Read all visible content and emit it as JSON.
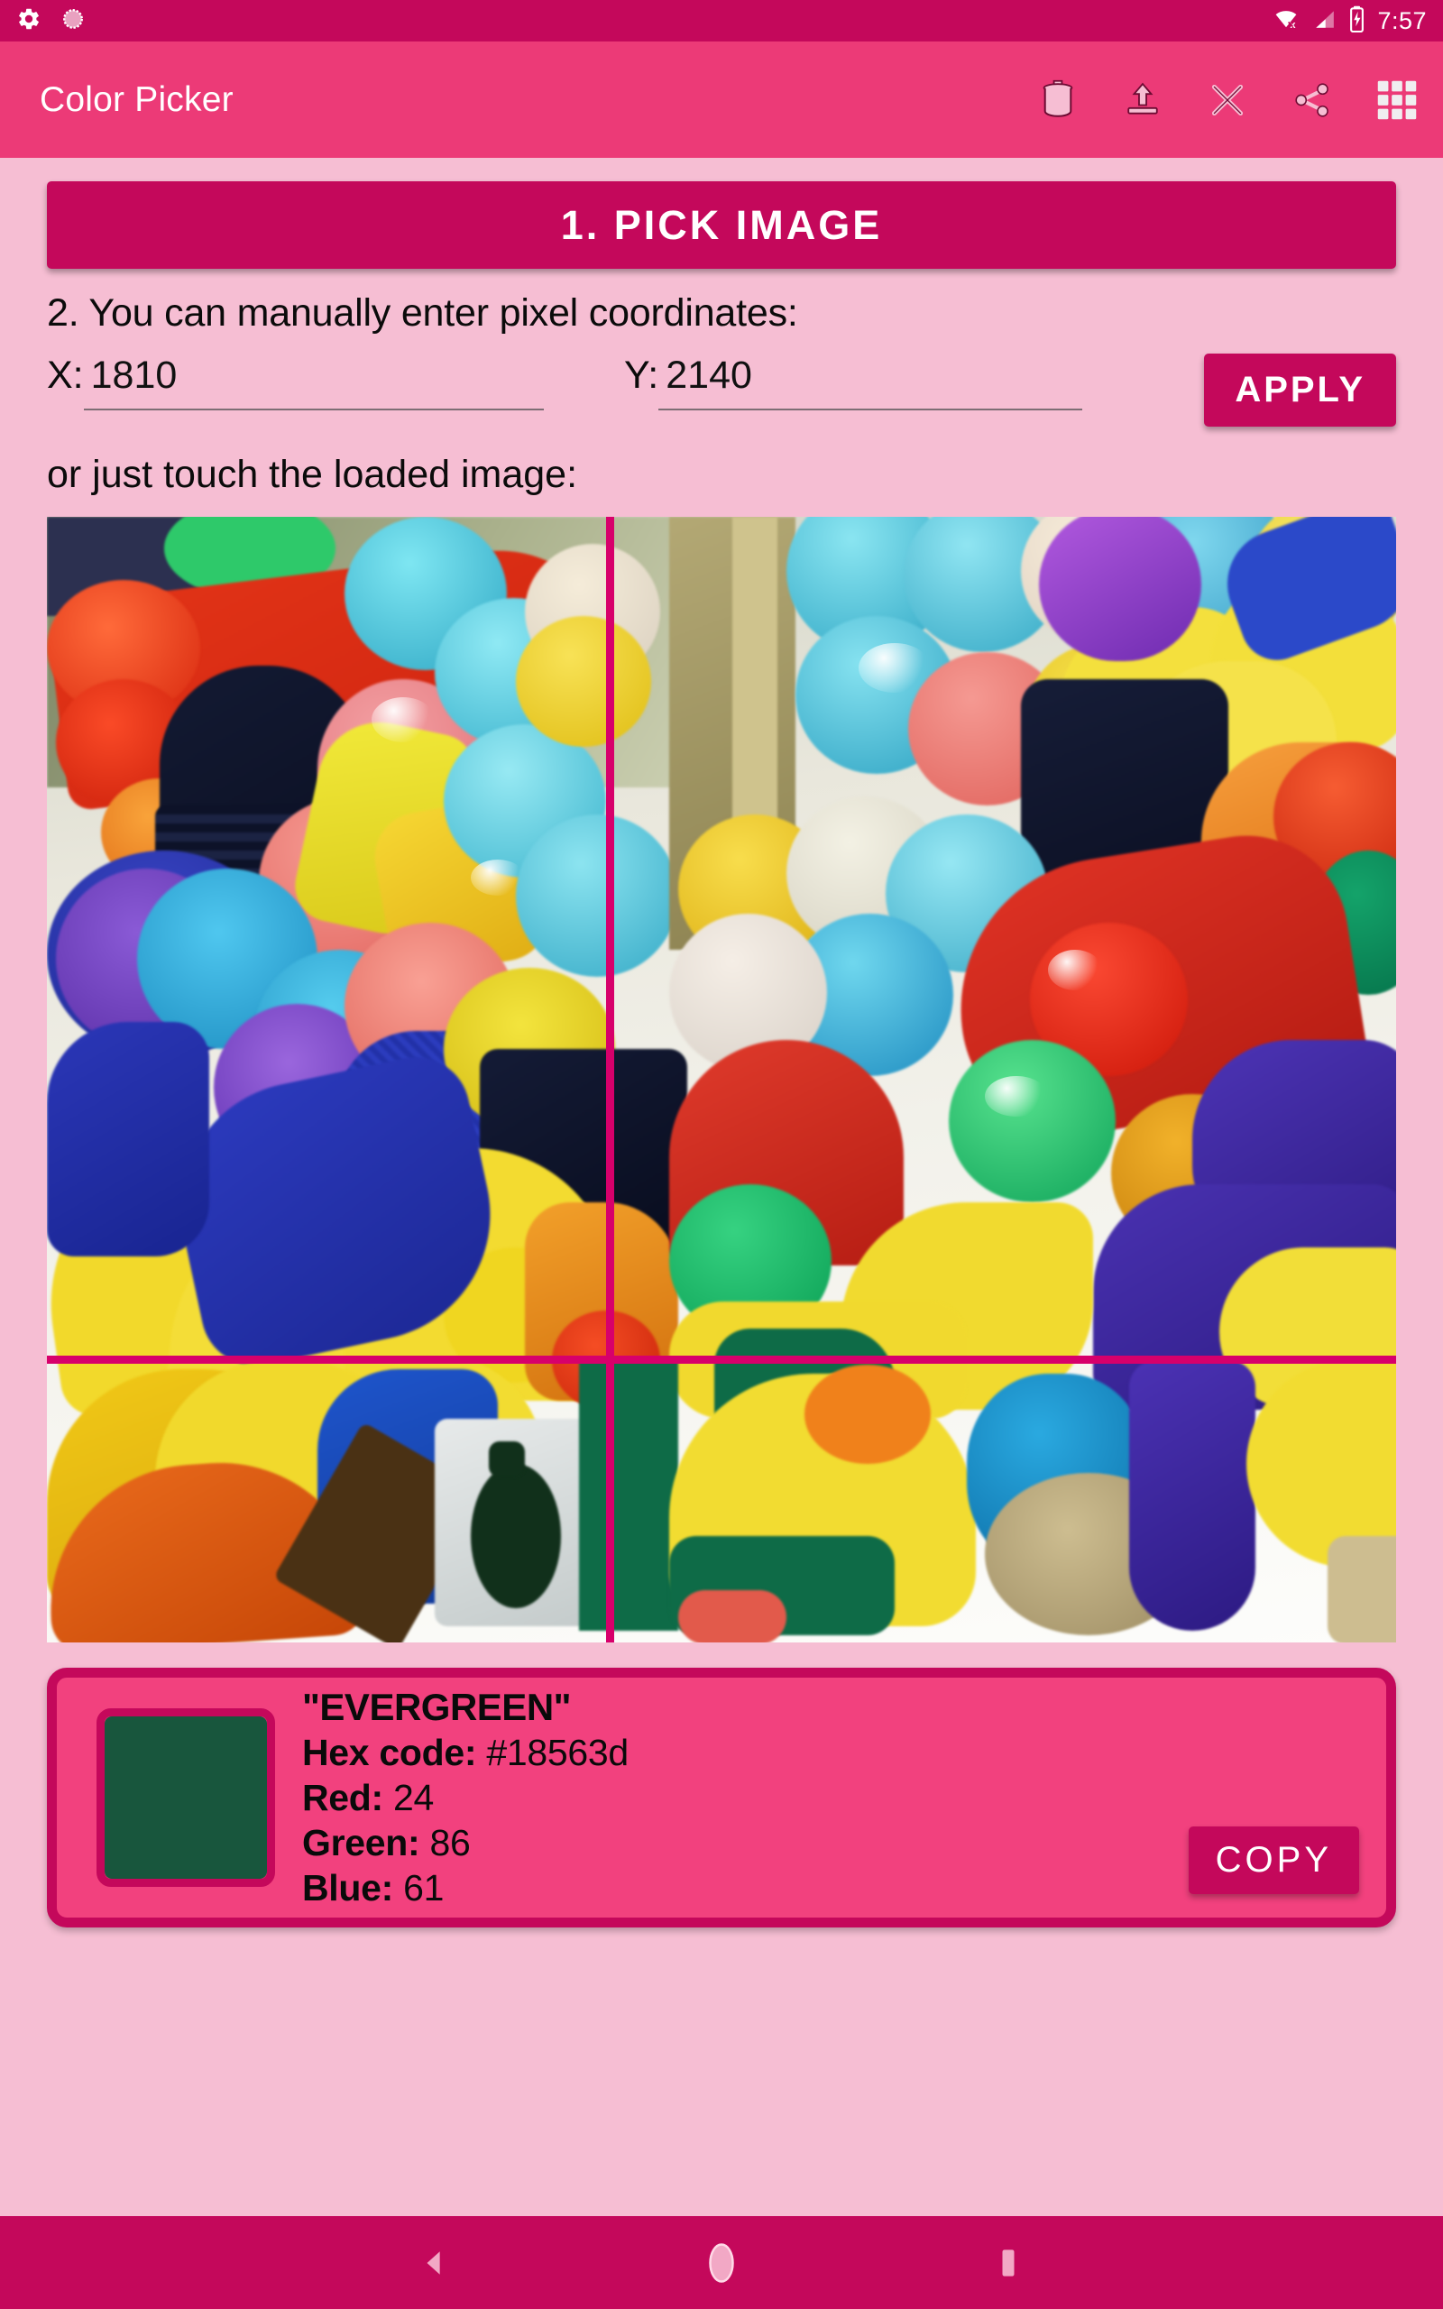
{
  "status_bar": {
    "icons": [
      "settings-icon",
      "sync-icon",
      "wifi-off-icon",
      "signal-icon",
      "battery-charging-icon"
    ],
    "clock": "7:57",
    "background": "#c4085b"
  },
  "app_bar": {
    "title": "Color Picker",
    "background": "#ec3a77",
    "actions": [
      {
        "name": "delete-icon",
        "label": "Delete"
      },
      {
        "name": "upload-icon",
        "label": "Upload"
      },
      {
        "name": "close-icon",
        "label": "Close"
      },
      {
        "name": "share-icon",
        "label": "Share"
      },
      {
        "name": "grid-icon",
        "label": "Apps"
      }
    ]
  },
  "main": {
    "background": "#f6bed3",
    "pick_image_label": "1. PICK IMAGE",
    "instruction_2": "2. You can manually enter pixel coordinates:",
    "instruction_3": "or just touch the loaded image:",
    "x_label": "X:",
    "x_value": "1810",
    "x_placeholder": "X",
    "y_label": "Y:",
    "y_value": "2140",
    "y_placeholder": "Y",
    "apply_label": "APPLY",
    "accent": "#c4085b",
    "crosshair_color": "#d7006b"
  },
  "result_card": {
    "color_name": "\"EVERGREEN\"",
    "hex_label": "Hex code:",
    "hex_value": "#18563d",
    "red_label": "Red:",
    "red_value": "24",
    "green_label": "Green:",
    "green_value": "86",
    "blue_label": "Blue:",
    "blue_value": "61",
    "copy_label": "COPY",
    "swatch_color": "#18563d",
    "card_background": "#f2417e",
    "card_border": "#c4085b"
  },
  "nav_bar": {
    "background": "#c4085b",
    "buttons": [
      {
        "name": "back-button"
      },
      {
        "name": "home-button"
      },
      {
        "name": "recents-button"
      }
    ]
  }
}
